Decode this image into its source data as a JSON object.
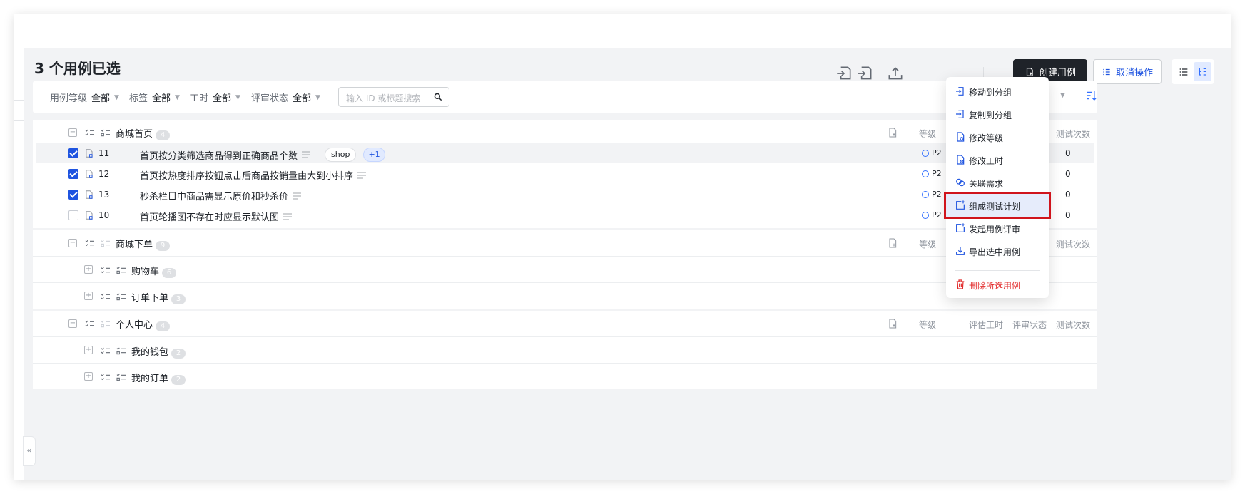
{
  "header": {
    "title": "3 个用例已选",
    "create_label": "创建用例",
    "cancel_label": "取消操作"
  },
  "filters": [
    {
      "label": "用例等级",
      "value": "全部"
    },
    {
      "label": "标签",
      "value": "全部"
    },
    {
      "label": "工时",
      "value": "全部"
    },
    {
      "label": "评审状态",
      "value": "全部"
    }
  ],
  "search": {
    "placeholder": "输入 ID 或标题搜索"
  },
  "columns": {
    "level": "等级",
    "estimate": "评估工时",
    "review": "评审状态",
    "runs": "测试次数"
  },
  "groups": [
    {
      "name": "商城首页",
      "count": "4",
      "cases": [
        {
          "id": "11",
          "title": "首页按分类筛选商品得到正确商品个数",
          "tags": [
            "shop",
            "+1"
          ],
          "priority": "P2",
          "runs": "0",
          "checked": true
        },
        {
          "id": "12",
          "title": "首页按热度排序按钮点击后商品按销量由大到小排序",
          "tags": [],
          "priority": "P2",
          "runs": "0",
          "checked": true
        },
        {
          "id": "13",
          "title": "秒杀栏目中商品需显示原价和秒杀价",
          "tags": [],
          "priority": "P2",
          "runs": "0",
          "checked": true
        },
        {
          "id": "10",
          "title": "首页轮播图不存在时应显示默认图",
          "tags": [],
          "priority": "P2",
          "runs": "0",
          "checked": false
        }
      ]
    },
    {
      "name": "商城下单",
      "count": "9",
      "subgroups": [
        {
          "name": "购物车",
          "count": "6"
        },
        {
          "name": "订单下单",
          "count": "3"
        }
      ]
    },
    {
      "name": "个人中心",
      "count": "4",
      "subgroups": [
        {
          "name": "我的钱包",
          "count": "2"
        },
        {
          "name": "我的订单",
          "count": "2"
        }
      ]
    }
  ],
  "menu": {
    "items": [
      {
        "label": "移动到分组",
        "icon": "move-to-group-icon"
      },
      {
        "label": "复制到分组",
        "icon": "copy-to-group-icon"
      },
      {
        "label": "修改等级",
        "icon": "edit-level-icon"
      },
      {
        "label": "修改工时",
        "icon": "edit-hours-icon"
      },
      {
        "label": "关联需求",
        "icon": "link-requirement-icon"
      },
      {
        "label": "组成测试计划",
        "icon": "test-plan-icon",
        "selected": true
      },
      {
        "label": "发起用例评审",
        "icon": "start-review-icon"
      },
      {
        "label": "导出选中用例",
        "icon": "export-icon"
      },
      {
        "label": "删除所选用例",
        "icon": "delete-icon",
        "danger": true
      }
    ]
  },
  "colors": {
    "primary": "#1f54e0",
    "accent": "#3370ff",
    "danger": "#e22b2b",
    "highlight_border": "#d0141c",
    "dark_button": "#1f2329"
  }
}
